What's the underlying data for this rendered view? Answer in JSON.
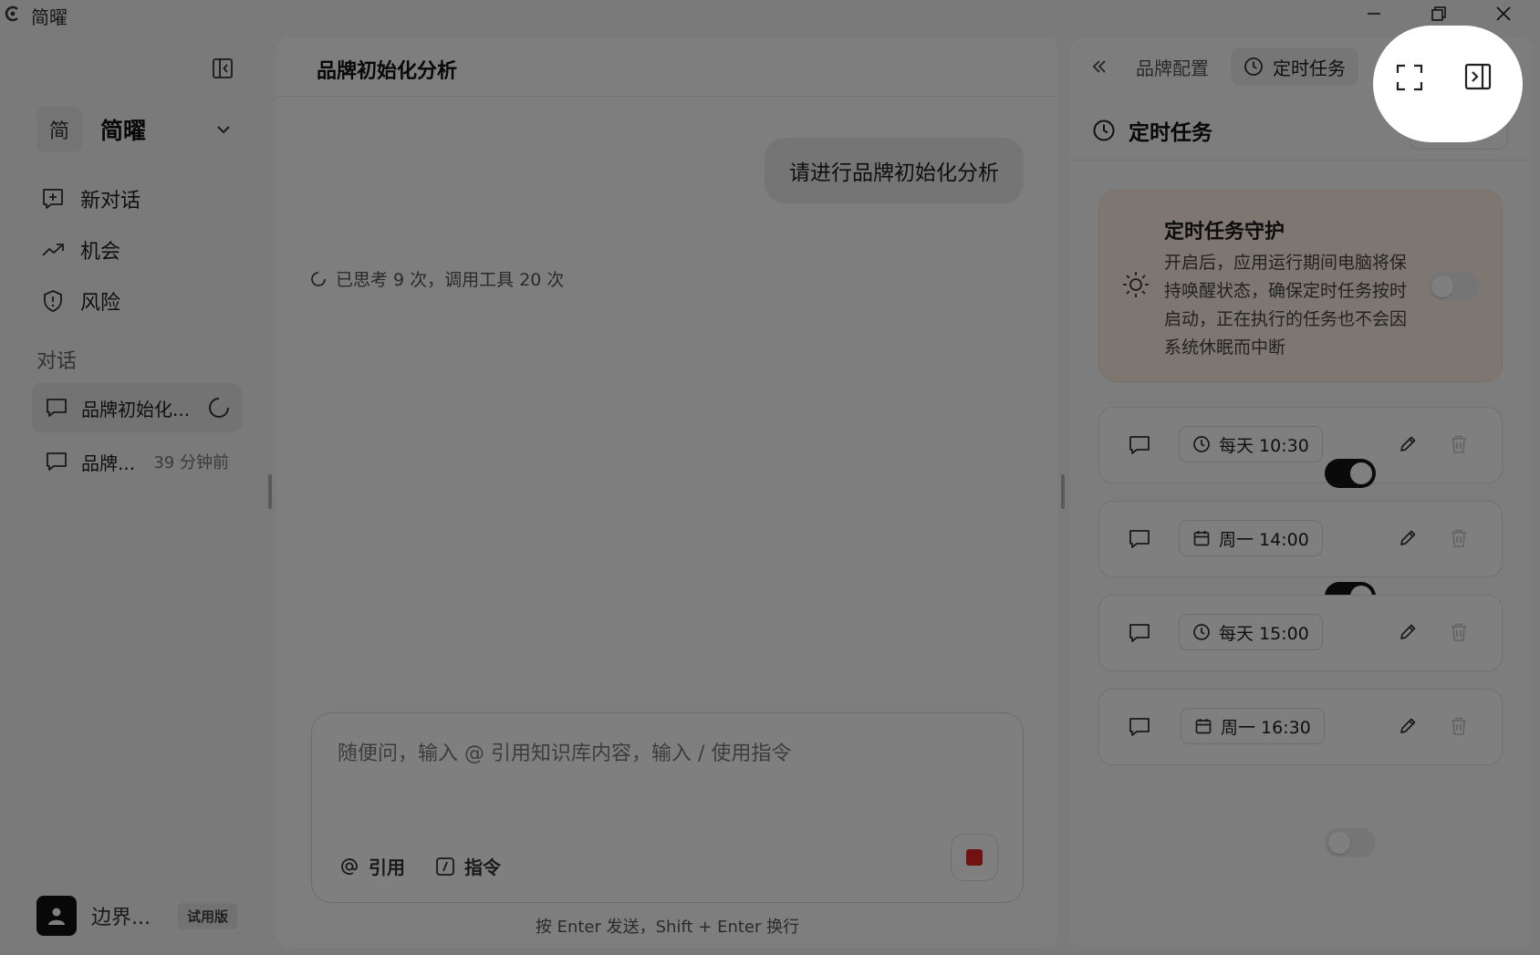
{
  "app": {
    "title": "简曜"
  },
  "workspace": {
    "avatar": "简",
    "name": "简曜"
  },
  "nav": [
    {
      "label": "新对话",
      "icon": "new-chat-icon"
    },
    {
      "label": "机会",
      "icon": "trending-up-icon"
    },
    {
      "label": "风险",
      "icon": "shield-icon"
    }
  ],
  "conversations": {
    "section_label": "对话",
    "items": [
      {
        "title": "品牌初始化...",
        "status": "loading"
      },
      {
        "title": "品牌...",
        "time": "39 分钟前"
      }
    ]
  },
  "user": {
    "name": "边界...",
    "badge": "试用版"
  },
  "chat": {
    "title": "品牌初始化分析",
    "user_message": "请进行品牌初始化分析",
    "thinking_status": "已思考 9 次，调用工具 20 次",
    "input_placeholder": "随便问，输入 @ 引用知识库内容，输入 / 使用指令",
    "cite_label": "引用",
    "command_label": "指令",
    "hint": "按 Enter 发送，Shift + Enter 换行"
  },
  "right_panel": {
    "tabs": [
      {
        "label": "品牌配置",
        "active": false
      },
      {
        "label": "定时任务",
        "active": true
      }
    ],
    "section_title": "定时任务",
    "guard": {
      "title": "定时任务守护",
      "description": "开启后，应用运行期间电脑将保持唤醒状态，确保定时任务按时启动，正在执行的任务也不会因系统休眠而中断",
      "enabled": false
    },
    "tasks": [
      {
        "schedule": "每天 10:30",
        "icon": "clock-icon",
        "enabled": true
      },
      {
        "schedule": "周一 14:00",
        "icon": "calendar-icon",
        "enabled": true
      },
      {
        "schedule": "每天 15:00",
        "icon": "clock-icon",
        "enabled": false
      },
      {
        "schedule": "周一 16:30",
        "icon": "calendar-icon",
        "enabled": false
      }
    ]
  },
  "colors": {
    "accent": "#141414",
    "stop": "#e02424",
    "guard_bg": "#fdeee2"
  }
}
